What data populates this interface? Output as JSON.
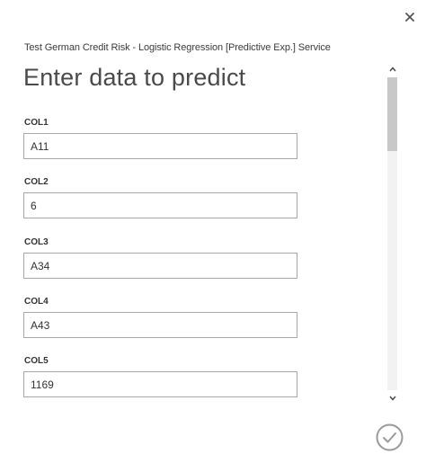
{
  "dialog": {
    "service_title": "Test German Credit Risk - Logistic Regression [Predictive Exp.] Service",
    "heading": "Enter data to predict"
  },
  "fields": [
    {
      "label": "COL1",
      "value": "A11"
    },
    {
      "label": "COL2",
      "value": "6"
    },
    {
      "label": "COL3",
      "value": "A34"
    },
    {
      "label": "COL4",
      "value": "A43"
    },
    {
      "label": "COL5",
      "value": "1169"
    }
  ],
  "icons": {
    "close": "close-icon",
    "scroll_up": "chevron-up-icon",
    "scroll_down": "chevron-down-icon",
    "submit": "checkmark-circle-icon"
  },
  "colors": {
    "accent_icon": "#9a9a9a",
    "input_border": "#a8a8a8",
    "scroll_thumb": "#c8c8c8"
  }
}
